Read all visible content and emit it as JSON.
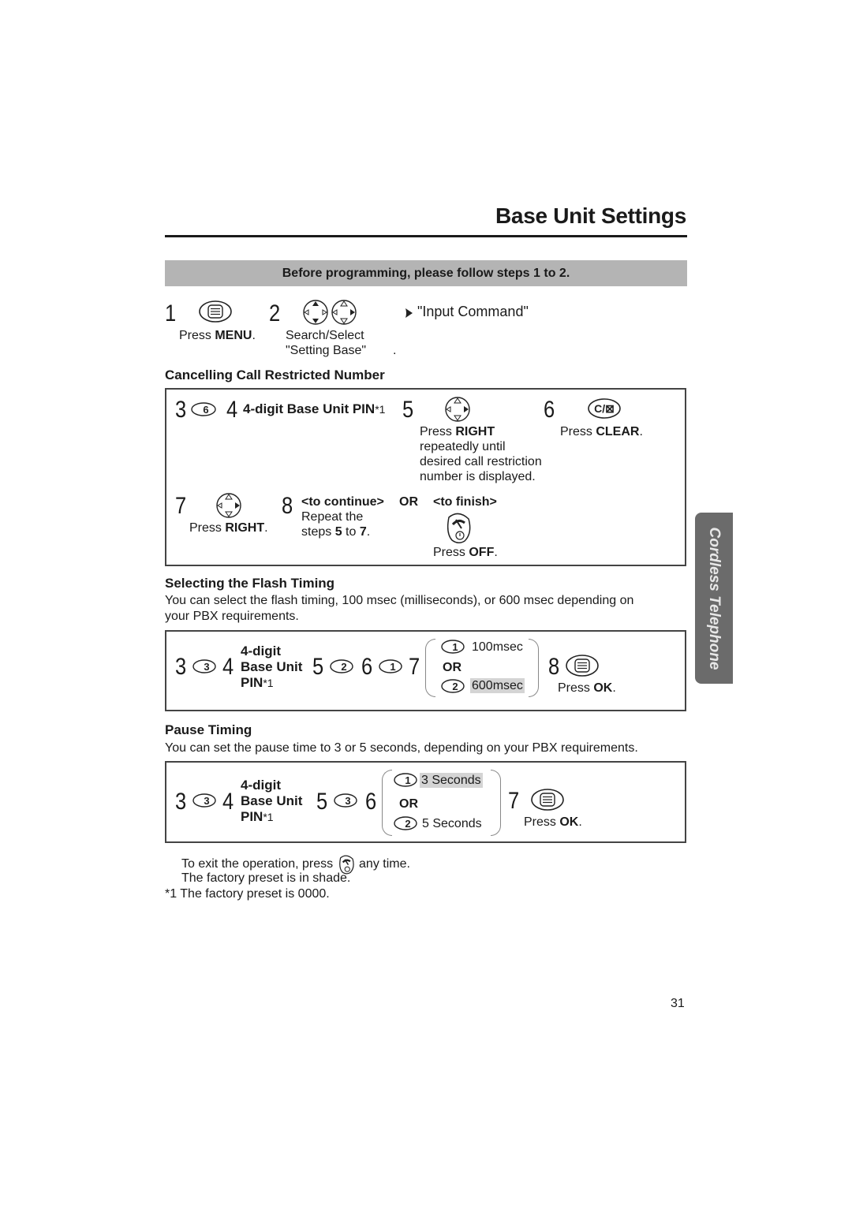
{
  "page": {
    "title": "Base Unit Settings",
    "page_number": "31",
    "side_tab": "Cordless Telephone"
  },
  "intro": {
    "banner": "Before programming, please follow steps 1 to 2.",
    "step1": {
      "num": "1",
      "icon": "menu-button-icon",
      "label_pre": "Press ",
      "label_bold": "MENU",
      "label_post": "."
    },
    "step2": {
      "num": "2",
      "icon": "navigator-up-down-right-icon",
      "line1": "Search/Select",
      "line2": "\"Setting Base\"",
      "dot": "."
    },
    "result": "\"Input Command\""
  },
  "cancelling": {
    "heading": "Cancelling Call Restricted Number",
    "s3": {
      "num": "3",
      "key": "6"
    },
    "s4": {
      "num": "4",
      "text": "4-digit Base Unit PIN",
      "sup": "*1"
    },
    "s5": {
      "num": "5",
      "line1_pre": "Press ",
      "line1_bold": "RIGHT",
      "line2": "repeatedly until",
      "line3": "desired call restriction",
      "line4": "number is displayed."
    },
    "s6": {
      "num": "6",
      "key": "C/⊠",
      "label_pre": "Press ",
      "label_bold": "CLEAR",
      "label_post": "."
    },
    "s7": {
      "num": "7",
      "label_pre": "Press ",
      "label_bold": "RIGHT",
      "label_post": "."
    },
    "s8": {
      "num": "8",
      "continue": "<to continue>",
      "or": "OR",
      "finish": "<to finish>",
      "repeat1": "Repeat the",
      "repeat2_pre": "steps ",
      "repeat2_b1": "5",
      "repeat2_mid": " to ",
      "repeat2_b2": "7",
      "repeat2_post": ".",
      "off_pre": "Press ",
      "off_bold": "OFF",
      "off_post": "."
    }
  },
  "flash": {
    "heading": "Selecting the Flash Timing",
    "desc1": "You can select the flash timing, 100 msec (milliseconds), or 600 msec depending on",
    "desc2": "your PBX requirements.",
    "s3": {
      "num": "3",
      "key": "3"
    },
    "s4": {
      "num": "4",
      "l1": "4-digit",
      "l2": "Base Unit",
      "l3": "PIN",
      "sup": "*1"
    },
    "s5": {
      "num": "5",
      "key": "2"
    },
    "s6": {
      "num": "6",
      "key": "1"
    },
    "s7": {
      "num": "7",
      "opt1_key": "1",
      "opt1": "100msec",
      "or": "OR",
      "opt2_key": "2",
      "opt2": "600msec",
      "preset": "600msec"
    },
    "s8": {
      "num": "8",
      "label_pre": "Press ",
      "label_bold": "OK",
      "label_post": "."
    }
  },
  "pause": {
    "heading": "Pause Timing",
    "desc": "You can set the pause time to 3 or 5 seconds, depending on your PBX requirements.",
    "s3": {
      "num": "3",
      "key": "3"
    },
    "s4": {
      "num": "4",
      "l1": "4-digit",
      "l2": "Base Unit",
      "l3": "PIN",
      "sup": "*1"
    },
    "s5": {
      "num": "5",
      "key": "3"
    },
    "s6": {
      "num": "6",
      "opt1_key": "1",
      "opt1": "3 Seconds",
      "or": "OR",
      "opt2_key": "2",
      "opt2": "5 Seconds",
      "preset": "3 Seconds"
    },
    "s7": {
      "num": "7",
      "label_pre": "Press ",
      "label_bold": "OK",
      "label_post": "."
    }
  },
  "notes": {
    "exit_pre": "To exit the operation, press",
    "exit_post": "any time.",
    "shade": "The factory preset is in shade.",
    "footnote": "*1 The factory preset is 0000."
  }
}
